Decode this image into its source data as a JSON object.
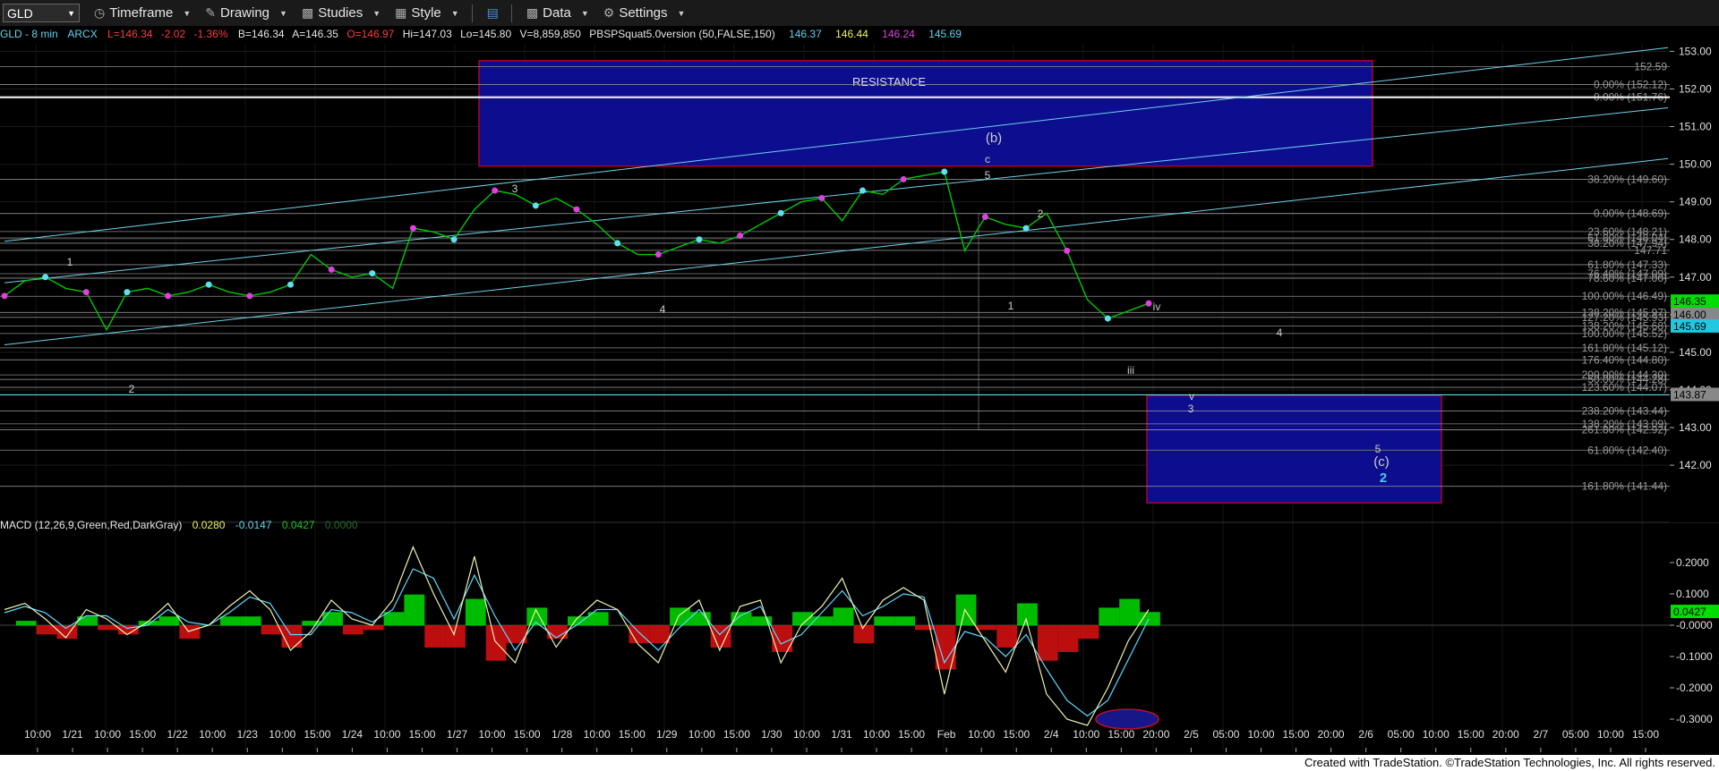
{
  "toolbar": {
    "symbol": "GLD",
    "timeframe": "Timeframe",
    "drawing": "Drawing",
    "studies": "Studies",
    "style": "Style",
    "data": "Data",
    "settings": "Settings"
  },
  "header": {
    "symbol_info": "GLD - 8 min",
    "exchange": "ARCX",
    "last": "L=146.34",
    "change": "-2.02",
    "change_pct": "-1.36%",
    "bid": "B=146.34",
    "ask": "A=146.35",
    "open": "O=146.97",
    "high": "Hi=147.03",
    "low": "Lo=145.80",
    "volume": "V=8,859,850",
    "study": "PBSPSquat5.0version (50,FALSE,150)",
    "study_values": [
      {
        "text": "146.37",
        "color": "#5fd3f0"
      },
      {
        "text": "146.44",
        "color": "#f0f060"
      },
      {
        "text": "146.24",
        "color": "#e040e0"
      },
      {
        "text": "145.69",
        "color": "#5fd3f0"
      }
    ]
  },
  "colors": {
    "background": "#000000",
    "price_bar": "#00c800",
    "channel": "#6fd3e8",
    "zone_fill": "#0d0d8f",
    "zone_border": "#b00030",
    "macd_pos": "#00dd00",
    "macd_neg": "#dd1010",
    "macd_line": "#f0f0b0",
    "signal_line": "#60d8ff"
  },
  "chart_data": [
    {
      "type": "line",
      "title": "GLD - 8 min",
      "price_axis": {
        "range": [
          140.6,
          153.2
        ],
        "ticks": [
          "153.00",
          "152.00",
          "151.00",
          "150.00",
          "149.00",
          "148.00",
          "147.00",
          "146.00",
          "145.00",
          "144.00",
          "143.00",
          "142.00"
        ]
      },
      "time_axis_ticks": [
        "10:00",
        "1/21",
        "10:00",
        "15:00",
        "1/22",
        "10:00",
        "1/23",
        "10:00",
        "15:00",
        "1/24",
        "10:00",
        "15:00",
        "1/27",
        "10:00",
        "15:00",
        "1/28",
        "10:00",
        "15:00",
        "1/29",
        "10:00",
        "15:00",
        "1/30",
        "10:00",
        "1/31",
        "10:00",
        "15:00",
        "Feb",
        "10:00",
        "15:00",
        "2/4",
        "10:00",
        "15:00",
        "20:00",
        "2/5",
        "05:00",
        "10:00",
        "15:00",
        "20:00",
        "2/6",
        "05:00",
        "10:00",
        "15:00",
        "20:00",
        "2/7",
        "05:00",
        "10:00",
        "15:00"
      ],
      "series": [
        {
          "values": [
            146.5,
            146.9,
            147.0,
            146.7,
            146.6,
            145.6,
            146.6,
            146.7,
            146.5,
            146.6,
            146.8,
            146.6,
            146.5,
            146.6,
            146.8,
            147.6,
            147.2,
            147.0,
            147.1,
            146.7,
            148.3,
            148.2,
            148.0,
            148.8,
            149.3,
            149.2,
            148.9,
            149.1,
            148.8,
            148.4,
            147.9,
            147.6,
            147.6,
            147.8,
            148.0,
            147.9,
            148.1,
            148.4,
            148.7,
            149.0,
            149.1,
            148.5,
            149.3,
            149.2,
            149.6,
            149.7,
            149.8,
            147.7,
            148.6,
            148.4,
            148.3,
            148.7,
            147.7,
            146.4,
            145.9,
            146.1,
            146.3
          ]
        }
      ],
      "resistance_zone": {
        "label": "RESISTANCE",
        "price_top": 152.75,
        "price_bottom": 149.95
      },
      "support_zone": {
        "price_top": 143.85,
        "price_bottom": 141.0
      },
      "channel_lines": [
        {
          "p1": [
            0,
            147.95
          ],
          "p2": [
            56,
            151.9
          ]
        },
        {
          "p1": [
            0,
            146.85
          ],
          "p2": [
            56,
            150.3
          ]
        },
        {
          "p1": [
            0,
            145.2
          ],
          "p2": [
            56,
            148.95
          ]
        }
      ],
      "horizontal_levels": [
        {
          "price": 152.59,
          "label": "152.59"
        },
        {
          "price": 152.12,
          "label": "0.00% (152.12)"
        },
        {
          "price": 151.78,
          "label": "0.00% (151.76)"
        },
        {
          "price": 149.6,
          "label": "38.20% (149.60)"
        },
        {
          "price": 148.69,
          "label": "0.00% (148.69)"
        },
        {
          "price": 148.21,
          "label": "23.60% (148.21)"
        },
        {
          "price": 148.04,
          "label": "61.80% (148.04)"
        },
        {
          "price": 147.9,
          "label": "38.20% (147.94)"
        },
        {
          "price": 147.71,
          "label": "147.71"
        },
        {
          "price": 147.33,
          "label": "61.80% (147.33)"
        },
        {
          "price": 147.09,
          "label": "76.40% (147.09)"
        },
        {
          "price": 146.97,
          "label": "78.60% (147.00)"
        },
        {
          "price": 146.49,
          "label": "100.00% (146.49)"
        },
        {
          "price": 146.06,
          "label": "138.20% (145.97)"
        },
        {
          "price": 145.93,
          "label": "127.20% (145.93)"
        },
        {
          "price": 145.7,
          "label": "138.20% (145.68)"
        },
        {
          "price": 145.5,
          "label": "100.00% (145.52)"
        },
        {
          "price": 145.12,
          "label": "161.80% (145.12)"
        },
        {
          "price": 144.8,
          "label": "176.40% (144.80)"
        },
        {
          "price": 144.4,
          "label": "200.00% (144.30)"
        },
        {
          "price": 144.28,
          "label": "50.00% (144.28)"
        },
        {
          "price": 144.07,
          "label": "123.60% (144.07)"
        },
        {
          "price": 143.44,
          "label": "238.20% (143.44)"
        },
        {
          "price": 143.1,
          "label": "138.20% (143.09)"
        },
        {
          "price": 142.94,
          "label": "261.80% (142.92)"
        },
        {
          "price": 142.4,
          "label": "61.80% (142.40)"
        },
        {
          "price": 141.44,
          "label": "161.80% (141.44)"
        }
      ],
      "price_markers": [
        {
          "price": 146.35,
          "label": "146.35",
          "color": "#00dd00"
        },
        {
          "price": 146.0,
          "label": "146.00",
          "color": "#888888"
        },
        {
          "price": 145.69,
          "label": "145.69",
          "color": "#20c8e0"
        },
        {
          "price": 143.87,
          "label": "143.87",
          "color": "#888888"
        }
      ],
      "wave_labels": [
        {
          "text": "1",
          "color": "#cccccc"
        },
        {
          "text": "2",
          "color": "#cccccc"
        },
        {
          "text": "3",
          "color": "#cccccc"
        },
        {
          "text": "4",
          "color": "#cccccc"
        },
        {
          "text": "(b)",
          "color": "#cccccc"
        },
        {
          "text": "c",
          "color": "#cccccc"
        },
        {
          "text": "5",
          "color": "#cccccc"
        },
        {
          "text": "2",
          "color": "#cccccc"
        },
        {
          "text": "1",
          "color": "#cccccc"
        },
        {
          "text": "iv",
          "color": "#cccccc"
        },
        {
          "text": "iii",
          "color": "#cccccc"
        },
        {
          "text": "4",
          "color": "#cccccc"
        },
        {
          "text": "v",
          "color": "#cccccc"
        },
        {
          "text": "3",
          "color": "#cccccc"
        },
        {
          "text": "5",
          "color": "#cccccc"
        },
        {
          "text": "(c)",
          "color": "#cccccc"
        },
        {
          "text": "2",
          "color": "#4fc8f0"
        }
      ]
    },
    {
      "type": "line",
      "title": "MACD (12,26,9,Green,Red,DarkGray)",
      "values_text": [
        {
          "text": "0.0280",
          "color": "#f0f060"
        },
        {
          "text": "-0.0147",
          "color": "#5fd3f0"
        },
        {
          "text": "0.0427",
          "color": "#20c020"
        },
        {
          "text": "0.0000",
          "color": "#207020"
        }
      ],
      "y_axis": {
        "range": [
          -0.4,
          0.3
        ],
        "ticks": [
          "0.2000",
          "0.1000",
          "-0.0000",
          "-0.1000",
          "-0.2000",
          "-0.3000"
        ]
      },
      "current_marker": {
        "value": 0.0427,
        "label": "0.0427",
        "color": "#00dd00"
      },
      "series": [
        {
          "values": [
            0.05,
            0.07,
            0.02,
            -0.04,
            0.05,
            0.02,
            -0.03,
            0.01,
            0.07,
            -0.02,
            0.0,
            0.06,
            0.11,
            0.05,
            -0.08,
            -0.02,
            0.08,
            0.02,
            0.0,
            0.08,
            0.25,
            0.1,
            -0.03,
            0.22,
            -0.05,
            -0.12,
            0.05,
            -0.07,
            0.02,
            0.08,
            0.05,
            -0.06,
            -0.12,
            0.03,
            0.08,
            -0.08,
            0.06,
            0.08,
            -0.12,
            0.0,
            0.06,
            0.15,
            -0.01,
            0.08,
            0.12,
            0.08,
            -0.22,
            0.05,
            -0.05,
            -0.15,
            0.02,
            -0.22,
            -0.3,
            -0.32,
            -0.2,
            -0.05,
            0.05
          ]
        },
        {
          "values": [
            0.04,
            0.06,
            0.04,
            -0.01,
            0.03,
            0.03,
            -0.01,
            0.0,
            0.05,
            0.01,
            0.0,
            0.04,
            0.09,
            0.07,
            -0.03,
            -0.03,
            0.05,
            0.04,
            0.01,
            0.05,
            0.18,
            0.15,
            0.02,
            0.16,
            0.03,
            -0.08,
            0.01,
            -0.04,
            0.0,
            0.05,
            0.05,
            -0.02,
            -0.08,
            -0.01,
            0.05,
            -0.03,
            0.03,
            0.06,
            -0.06,
            -0.03,
            0.04,
            0.11,
            0.03,
            0.06,
            0.1,
            0.09,
            -0.12,
            -0.02,
            -0.04,
            -0.1,
            -0.03,
            -0.14,
            -0.24,
            -0.29,
            -0.24,
            -0.11,
            0.02
          ]
        }
      ],
      "highlight_ellipse_value": -0.3
    }
  ],
  "footer": {
    "text": "Created with TradeStation. ©TradeStation Technologies, Inc. All rights reserved."
  }
}
